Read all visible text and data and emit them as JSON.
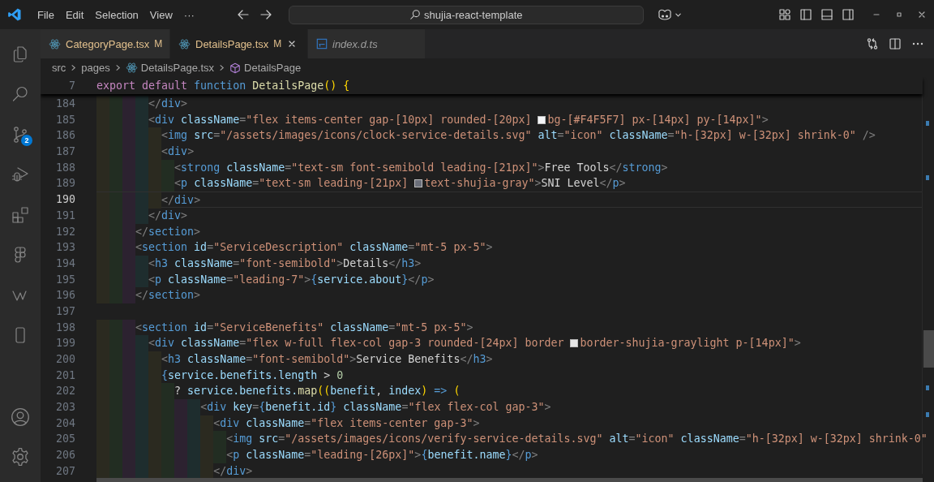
{
  "title_bar": {
    "menus": [
      "File",
      "Edit",
      "Selection",
      "View"
    ],
    "more": "···",
    "search": "shujia-react-template"
  },
  "activity_bar": {
    "items": [
      {
        "kind": "files"
      },
      {
        "kind": "search"
      },
      {
        "kind": "source-control",
        "badge": "2"
      },
      {
        "kind": "run-debug"
      },
      {
        "kind": "extensions"
      },
      {
        "kind": "figma"
      },
      {
        "kind": "wave"
      },
      {
        "kind": "phone"
      }
    ],
    "bottom_items": [
      {
        "kind": "account"
      },
      {
        "kind": "settings"
      }
    ]
  },
  "tabs": [
    {
      "label": "CategoryPage.tsx",
      "kind": "react",
      "modified": "M",
      "selected": false,
      "preview": false
    },
    {
      "label": "DetailsPage.tsx",
      "kind": "react",
      "modified": "M",
      "selected": true,
      "preview": false
    },
    {
      "label": "index.d.ts",
      "kind": "ts",
      "selected": false,
      "preview": true
    }
  ],
  "breadcrumbs": [
    {
      "label": "src",
      "kind": "folder"
    },
    {
      "label": "pages",
      "kind": "folder"
    },
    {
      "label": "DetailsPage.tsx",
      "kind": "react"
    },
    {
      "label": "DetailsPage",
      "kind": "symbol"
    }
  ],
  "sticky_line": {
    "number": "7",
    "tokens": [
      {
        "text": "export default ",
        "kind": "kw"
      },
      {
        "text": "function ",
        "kind": "tag"
      },
      {
        "text": "DetailsPage",
        "kind": "fn"
      },
      {
        "text": "() {",
        "kind": "bracket"
      }
    ]
  },
  "lines": [
    {
      "number": "184",
      "current": false,
      "tokens": [
        {
          "text": "        </",
          "kind": "punct"
        },
        {
          "text": "div",
          "kind": "tag"
        },
        {
          "text": ">",
          "kind": "punct"
        }
      ]
    },
    {
      "number": "185",
      "current": false,
      "tokens": [
        {
          "text": "        <",
          "kind": "punct"
        },
        {
          "text": "div",
          "kind": "tag"
        },
        {
          "text": " className",
          "kind": "attr"
        },
        {
          "text": "=",
          "kind": "punct"
        },
        {
          "text": "\"flex items-center gap-[10px] rounded-[20px] ",
          "kind": "str"
        },
        {
          "kind": "swatch",
          "color": "#f4f5f7"
        },
        {
          "text": "bg-[#F4F5F7] px-[14px] py-[14px]\"",
          "kind": "str"
        },
        {
          "text": ">",
          "kind": "punct"
        }
      ]
    },
    {
      "number": "186",
      "current": false,
      "tokens": [
        {
          "text": "          <",
          "kind": "punct"
        },
        {
          "text": "img",
          "kind": "tag"
        },
        {
          "text": " src",
          "kind": "attr"
        },
        {
          "text": "=",
          "kind": "punct"
        },
        {
          "text": "\"/assets/images/icons/clock-service-details.svg\"",
          "kind": "str"
        },
        {
          "text": " alt",
          "kind": "attr"
        },
        {
          "text": "=",
          "kind": "punct"
        },
        {
          "text": "\"icon\"",
          "kind": "str"
        },
        {
          "text": " className",
          "kind": "attr"
        },
        {
          "text": "=",
          "kind": "punct"
        },
        {
          "text": "\"h-[32px] w-[32px] shrink-0\"",
          "kind": "str"
        },
        {
          "text": " />",
          "kind": "punct"
        }
      ]
    },
    {
      "number": "187",
      "current": false,
      "tokens": [
        {
          "text": "          <",
          "kind": "punct"
        },
        {
          "text": "div",
          "kind": "tag"
        },
        {
          "text": ">",
          "kind": "punct"
        }
      ]
    },
    {
      "number": "188",
      "current": false,
      "tokens": [
        {
          "text": "            <",
          "kind": "punct"
        },
        {
          "text": "strong",
          "kind": "tag"
        },
        {
          "text": " className",
          "kind": "attr"
        },
        {
          "text": "=",
          "kind": "punct"
        },
        {
          "text": "\"text-sm font-semibold leading-[21px]\"",
          "kind": "str"
        },
        {
          "text": ">",
          "kind": "punct"
        },
        {
          "text": "Free Tools",
          "kind": "text"
        },
        {
          "text": "</",
          "kind": "punct"
        },
        {
          "text": "strong",
          "kind": "tag"
        },
        {
          "text": ">",
          "kind": "punct"
        }
      ]
    },
    {
      "number": "189",
      "current": false,
      "tokens": [
        {
          "text": "            <",
          "kind": "punct"
        },
        {
          "text": "p",
          "kind": "tag"
        },
        {
          "text": " className",
          "kind": "attr"
        },
        {
          "text": "=",
          "kind": "punct"
        },
        {
          "text": "\"text-sm leading-[21px] ",
          "kind": "str"
        },
        {
          "kind": "swatch",
          "color": "#6b6f7a"
        },
        {
          "text": "text-shujia-gray\"",
          "kind": "str"
        },
        {
          "text": ">",
          "kind": "punct"
        },
        {
          "text": "SNI Level",
          "kind": "text"
        },
        {
          "text": "</",
          "kind": "punct"
        },
        {
          "text": "p",
          "kind": "tag"
        },
        {
          "text": ">",
          "kind": "punct"
        }
      ]
    },
    {
      "number": "190",
      "current": true,
      "tokens": [
        {
          "text": "          </",
          "kind": "punct"
        },
        {
          "text": "div",
          "kind": "tag"
        },
        {
          "text": ">",
          "kind": "punct"
        }
      ]
    },
    {
      "number": "191",
      "current": false,
      "tokens": [
        {
          "text": "        </",
          "kind": "punct"
        },
        {
          "text": "div",
          "kind": "tag"
        },
        {
          "text": ">",
          "kind": "punct"
        }
      ]
    },
    {
      "number": "192",
      "current": false,
      "tokens": [
        {
          "text": "      </",
          "kind": "punct"
        },
        {
          "text": "section",
          "kind": "tag"
        },
        {
          "text": ">",
          "kind": "punct"
        }
      ]
    },
    {
      "number": "193",
      "current": false,
      "tokens": [
        {
          "text": "      <",
          "kind": "punct"
        },
        {
          "text": "section",
          "kind": "tag"
        },
        {
          "text": " id",
          "kind": "attr"
        },
        {
          "text": "=",
          "kind": "punct"
        },
        {
          "text": "\"ServiceDescription\"",
          "kind": "str"
        },
        {
          "text": " className",
          "kind": "attr"
        },
        {
          "text": "=",
          "kind": "punct"
        },
        {
          "text": "\"mt-5 px-5\"",
          "kind": "str"
        },
        {
          "text": ">",
          "kind": "punct"
        }
      ]
    },
    {
      "number": "194",
      "current": false,
      "tokens": [
        {
          "text": "        <",
          "kind": "punct"
        },
        {
          "text": "h3",
          "kind": "tag"
        },
        {
          "text": " className",
          "kind": "attr"
        },
        {
          "text": "=",
          "kind": "punct"
        },
        {
          "text": "\"font-semibold\"",
          "kind": "str"
        },
        {
          "text": ">",
          "kind": "punct"
        },
        {
          "text": "Details",
          "kind": "text"
        },
        {
          "text": "</",
          "kind": "punct"
        },
        {
          "text": "h3",
          "kind": "tag"
        },
        {
          "text": ">",
          "kind": "punct"
        }
      ]
    },
    {
      "number": "195",
      "current": false,
      "tokens": [
        {
          "text": "        <",
          "kind": "punct"
        },
        {
          "text": "p",
          "kind": "tag"
        },
        {
          "text": " className",
          "kind": "attr"
        },
        {
          "text": "=",
          "kind": "punct"
        },
        {
          "text": "\"leading-7\"",
          "kind": "str"
        },
        {
          "text": ">",
          "kind": "punct"
        },
        {
          "text": "{",
          "kind": "brace"
        },
        {
          "text": "service.about",
          "kind": "var"
        },
        {
          "text": "}",
          "kind": "brace"
        },
        {
          "text": "</",
          "kind": "punct"
        },
        {
          "text": "p",
          "kind": "tag"
        },
        {
          "text": ">",
          "kind": "punct"
        }
      ]
    },
    {
      "number": "196",
      "current": false,
      "tokens": [
        {
          "text": "      </",
          "kind": "punct"
        },
        {
          "text": "section",
          "kind": "tag"
        },
        {
          "text": ">",
          "kind": "punct"
        }
      ]
    },
    {
      "number": "197",
      "current": false
    },
    {
      "number": "198",
      "current": false,
      "tokens": [
        {
          "text": "      <",
          "kind": "punct"
        },
        {
          "text": "section",
          "kind": "tag"
        },
        {
          "text": " id",
          "kind": "attr"
        },
        {
          "text": "=",
          "kind": "punct"
        },
        {
          "text": "\"ServiceBenefits\"",
          "kind": "str"
        },
        {
          "text": " className",
          "kind": "attr"
        },
        {
          "text": "=",
          "kind": "punct"
        },
        {
          "text": "\"mt-5 px-5\"",
          "kind": "str"
        },
        {
          "text": ">",
          "kind": "punct"
        }
      ]
    },
    {
      "number": "199",
      "current": false,
      "tokens": [
        {
          "text": "        <",
          "kind": "punct"
        },
        {
          "text": "div",
          "kind": "tag"
        },
        {
          "text": " className",
          "kind": "attr"
        },
        {
          "text": "=",
          "kind": "punct"
        },
        {
          "text": "\"flex w-full flex-col gap-3 rounded-[24px] border ",
          "kind": "str"
        },
        {
          "kind": "swatch",
          "color": "#e6e6e6"
        },
        {
          "text": "border-shujia-graylight p-[14px]\"",
          "kind": "str"
        },
        {
          "text": ">",
          "kind": "punct"
        }
      ]
    },
    {
      "number": "200",
      "current": false,
      "tokens": [
        {
          "text": "          <",
          "kind": "punct"
        },
        {
          "text": "h3",
          "kind": "tag"
        },
        {
          "text": " className",
          "kind": "attr"
        },
        {
          "text": "=",
          "kind": "punct"
        },
        {
          "text": "\"font-semibold\"",
          "kind": "str"
        },
        {
          "text": ">",
          "kind": "punct"
        },
        {
          "text": "Service Benefits",
          "kind": "text"
        },
        {
          "text": "</",
          "kind": "punct"
        },
        {
          "text": "h3",
          "kind": "tag"
        },
        {
          "text": ">",
          "kind": "punct"
        }
      ]
    },
    {
      "number": "201",
      "current": false,
      "tokens": [
        {
          "text": "          {",
          "kind": "brace"
        },
        {
          "text": "service.benefits.length",
          "kind": "var"
        },
        {
          "text": " > ",
          "kind": "text"
        },
        {
          "text": "0",
          "kind": "num"
        }
      ]
    },
    {
      "number": "202",
      "current": false,
      "tokens": [
        {
          "text": "            ? ",
          "kind": "text"
        },
        {
          "text": "service.benefits.",
          "kind": "var"
        },
        {
          "text": "map",
          "kind": "fn"
        },
        {
          "text": "((",
          "kind": "bracket"
        },
        {
          "text": "benefit",
          "kind": "var"
        },
        {
          "text": ", ",
          "kind": "text"
        },
        {
          "text": "index",
          "kind": "var"
        },
        {
          "text": ")",
          "kind": "bracket"
        },
        {
          "text": " => ",
          "kind": "tag"
        },
        {
          "text": "(",
          "kind": "bracket"
        }
      ]
    },
    {
      "number": "203",
      "current": false,
      "tokens": [
        {
          "text": "                <",
          "kind": "punct"
        },
        {
          "text": "div",
          "kind": "tag"
        },
        {
          "text": " key",
          "kind": "attr"
        },
        {
          "text": "=",
          "kind": "punct"
        },
        {
          "text": "{",
          "kind": "brace"
        },
        {
          "text": "benefit.id",
          "kind": "var"
        },
        {
          "text": "}",
          "kind": "brace"
        },
        {
          "text": " className",
          "kind": "attr"
        },
        {
          "text": "=",
          "kind": "punct"
        },
        {
          "text": "\"flex flex-col gap-3\"",
          "kind": "str"
        },
        {
          "text": ">",
          "kind": "punct"
        }
      ]
    },
    {
      "number": "204",
      "current": false,
      "tokens": [
        {
          "text": "                  <",
          "kind": "punct"
        },
        {
          "text": "div",
          "kind": "tag"
        },
        {
          "text": " className",
          "kind": "attr"
        },
        {
          "text": "=",
          "kind": "punct"
        },
        {
          "text": "\"flex items-center gap-3\"",
          "kind": "str"
        },
        {
          "text": ">",
          "kind": "punct"
        }
      ]
    },
    {
      "number": "205",
      "current": false,
      "tokens": [
        {
          "text": "                    <",
          "kind": "punct"
        },
        {
          "text": "img",
          "kind": "tag"
        },
        {
          "text": " src",
          "kind": "attr"
        },
        {
          "text": "=",
          "kind": "punct"
        },
        {
          "text": "\"/assets/images/icons/verify-service-details.svg\"",
          "kind": "str"
        },
        {
          "text": " alt",
          "kind": "attr"
        },
        {
          "text": "=",
          "kind": "punct"
        },
        {
          "text": "\"icon\"",
          "kind": "str"
        },
        {
          "text": " className",
          "kind": "attr"
        },
        {
          "text": "=",
          "kind": "punct"
        },
        {
          "text": "\"h-[32px] w-[32px] shrink-0\"",
          "kind": "str"
        }
      ]
    },
    {
      "number": "206",
      "current": false,
      "tokens": [
        {
          "text": "                    <",
          "kind": "punct"
        },
        {
          "text": "p",
          "kind": "tag"
        },
        {
          "text": " className",
          "kind": "attr"
        },
        {
          "text": "=",
          "kind": "punct"
        },
        {
          "text": "\"leading-[26px]\"",
          "kind": "str"
        },
        {
          "text": ">",
          "kind": "punct"
        },
        {
          "text": "{",
          "kind": "brace"
        },
        {
          "text": "benefit.name",
          "kind": "var"
        },
        {
          "text": "}",
          "kind": "brace"
        },
        {
          "text": "</",
          "kind": "punct"
        },
        {
          "text": "p",
          "kind": "tag"
        },
        {
          "text": ">",
          "kind": "punct"
        }
      ]
    },
    {
      "number": "207",
      "current": false,
      "tokens": [
        {
          "text": "                  </",
          "kind": "punct"
        },
        {
          "text": "div",
          "kind": "tag"
        },
        {
          "text": ">",
          "kind": "punct"
        }
      ]
    }
  ]
}
